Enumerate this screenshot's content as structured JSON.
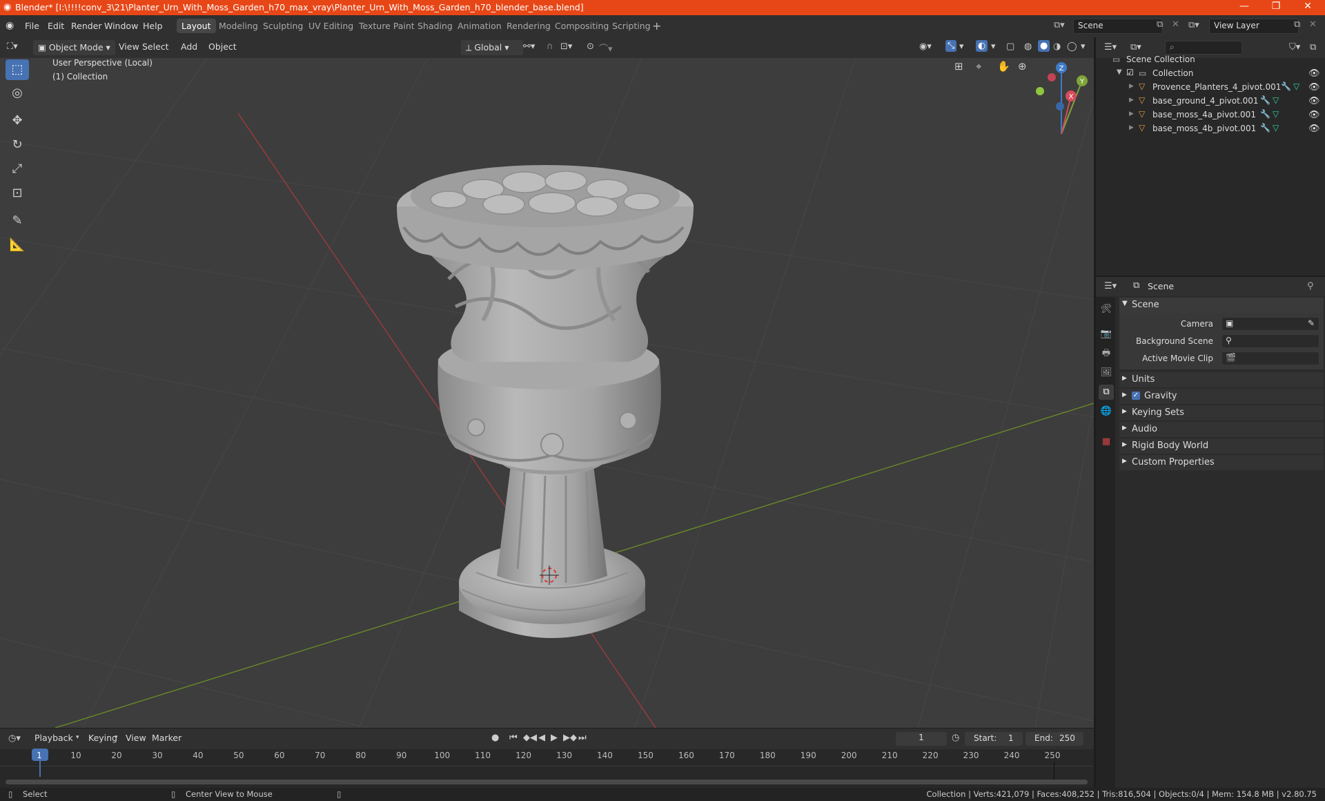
{
  "titlebar": {
    "title": "Blender* [I:\\!!!!conv_3\\21\\Planter_Urn_With_Moss_Garden_h70_max_vray\\Planter_Urn_With_Moss_Garden_h70_blender_base.blend]",
    "accent": "#e74717"
  },
  "menu": [
    "File",
    "Edit",
    "Render",
    "Window",
    "Help"
  ],
  "workspaces": [
    "Layout",
    "Modeling",
    "Sculpting",
    "UV Editing",
    "Texture Paint",
    "Shading",
    "Animation",
    "Rendering",
    "Compositing",
    "Scripting"
  ],
  "active_workspace": "Layout",
  "scene_field": "Scene",
  "view_layer_field": "View Layer",
  "viewport_header": {
    "mode": "Object Mode",
    "menus": [
      "View",
      "Select",
      "Add",
      "Object"
    ],
    "orientation": "Global"
  },
  "viewport": {
    "perspective_label": "User Perspective (Local)",
    "collection_label": "(1) Collection",
    "gizmo": {
      "z": "Z",
      "y": "Y",
      "x": "X"
    }
  },
  "outliner": {
    "root": "Scene Collection",
    "collection": "Collection",
    "objects": [
      "Provence_Planters_4_pivot.001",
      "base_ground_4_pivot.001",
      "base_moss_4a_pivot.001",
      "base_moss_4b_pivot.001"
    ]
  },
  "properties": {
    "header": "Scene",
    "panel_title": "Scene",
    "camera_label": "Camera",
    "background_scene_label": "Background Scene",
    "active_movie_clip_label": "Active Movie Clip",
    "sections": [
      "Units",
      "Gravity",
      "Keying Sets",
      "Audio",
      "Rigid Body World",
      "Custom Properties"
    ],
    "gravity_checked": true
  },
  "timeline": {
    "menus": [
      "Playback",
      "Keying",
      "View",
      "Marker"
    ],
    "current_frame": "1",
    "start_label": "Start:",
    "start": "1",
    "end_label": "End:",
    "end": "250",
    "ticks": [
      "1",
      "10",
      "20",
      "30",
      "40",
      "50",
      "60",
      "70",
      "80",
      "90",
      "100",
      "110",
      "120",
      "130",
      "140",
      "150",
      "160",
      "170",
      "180",
      "190",
      "200",
      "210",
      "220",
      "230",
      "240",
      "250"
    ]
  },
  "statusbar": {
    "left_action": "Select",
    "middle_action": "Center View to Mouse",
    "stats": "Collection | Verts:421,079 | Faces:408,252 | Tris:816,504 | Objects:0/4 | Mem: 154.8 MB | v2.80.75"
  }
}
